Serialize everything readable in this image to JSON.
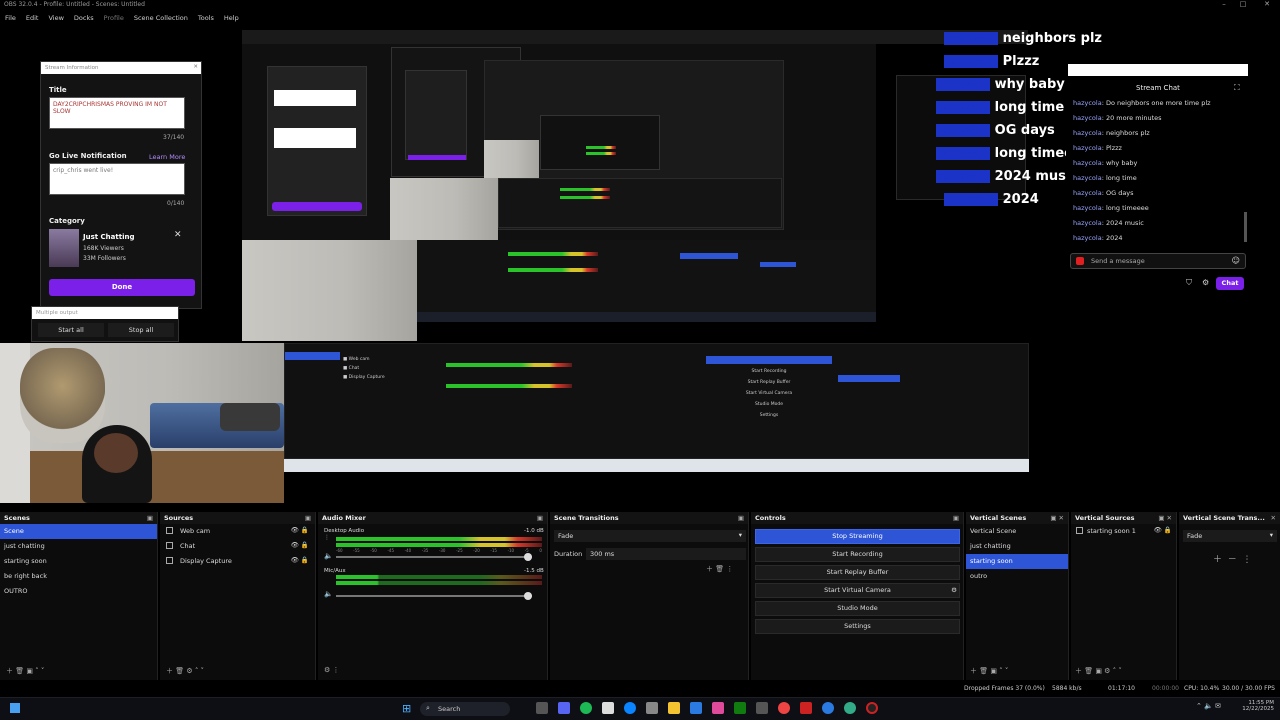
{
  "window": {
    "title": "OBS 32.0.4 - Profile: Untitled - Scenes: Untitled",
    "min": "–",
    "max": "□",
    "close": "✕"
  },
  "menu": [
    "File",
    "Edit",
    "View",
    "Docks",
    "Profile",
    "Scene Collection",
    "Tools",
    "Help"
  ],
  "stream_info": {
    "header": "Stream Information",
    "title_label": "Title",
    "title_value": "DAY2CRIPCHRISMAS PROVING IM NOT SLOW",
    "title_count": "37/140",
    "golive_label": "Go Live Notification",
    "learn_more": "Learn More",
    "golive_value": "crip_chris went live!",
    "golive_count": "0/140",
    "category_label": "Category",
    "category_name": "Just Chatting",
    "viewers": "168K Viewers",
    "followers": "33M Followers",
    "done": "Done",
    "multiple_output": "Multiple output",
    "start_all": "Start all",
    "stop_all": "Stop all"
  },
  "overlay_words": [
    "neighbors plz",
    "Plzzz",
    "why baby",
    "long time",
    "OG days",
    "long timeeee",
    "2024 music",
    "2024"
  ],
  "overlay_user": "hazycola",
  "chat": {
    "title": "Stream Chat",
    "messages": [
      {
        "user": "hazycola",
        "text": "Do neighbors one more time plz"
      },
      {
        "user": "hazycola",
        "text": "20 more minutes"
      },
      {
        "user": "hazycola",
        "text": "neighbors plz"
      },
      {
        "user": "hazycola",
        "text": "Plzzz"
      },
      {
        "user": "hazycola",
        "text": "why baby"
      },
      {
        "user": "hazycola",
        "text": "long time"
      },
      {
        "user": "hazycola",
        "text": "OG days"
      },
      {
        "user": "hazycola",
        "text": "long timeeee"
      },
      {
        "user": "hazycola",
        "text": "2024 music"
      },
      {
        "user": "hazycola",
        "text": "2024"
      }
    ],
    "placeholder": "Send a message",
    "chat_button": "Chat"
  },
  "docks": {
    "scenes": {
      "title": "Scenes",
      "items": [
        "Scene",
        "just chatting",
        "starting soon",
        "be right back",
        "OUTRO"
      ],
      "selected": 0
    },
    "sources": {
      "title": "Sources",
      "items": [
        "Web cam",
        "Chat",
        "Display Capture"
      ]
    },
    "audio": {
      "title": "Audio Mixer",
      "ch1": "Desktop Audio",
      "ch1_db": "-1.0 dB",
      "ch2": "Mic/Aux",
      "ch2_db": "-1.5 dB",
      "ticks": [
        "-60",
        "-55",
        "-50",
        "-45",
        "-40",
        "-35",
        "-30",
        "-25",
        "-20",
        "-15",
        "-10",
        "-5",
        "0"
      ]
    },
    "transitions": {
      "title": "Scene Transitions",
      "type": "Fade",
      "duration_label": "Duration",
      "duration_value": "300 ms"
    },
    "controls": {
      "title": "Controls",
      "buttons": [
        "Stop Streaming",
        "Start Recording",
        "Start Replay Buffer",
        "Start Virtual Camera",
        "Studio Mode",
        "Settings"
      ]
    },
    "vscenes": {
      "title": "Vertical Scenes",
      "items": [
        "Vertical Scene",
        "just chatting",
        "starting soon",
        "outro"
      ],
      "selected": 2
    },
    "vsources": {
      "title": "Vertical Sources",
      "items": [
        "starting soon 1"
      ]
    },
    "vtrans": {
      "title": "Vertical Scene Trans...",
      "type": "Fade"
    }
  },
  "status": {
    "dropped": "Dropped Frames 37 (0.0%)",
    "kbps": "5884 kb/s",
    "live_time": "01:17:10",
    "rec_time": "00:00:00",
    "cpu": "CPU: 10.4%",
    "fps": "30.00 / 30.00 FPS"
  },
  "taskbar": {
    "search": "Search",
    "time": "11:55 PM",
    "date": "12/22/2025"
  },
  "colors": {
    "accent": "#2d55d6",
    "twitch": "#7b20e8",
    "live_red": "#e02020"
  }
}
